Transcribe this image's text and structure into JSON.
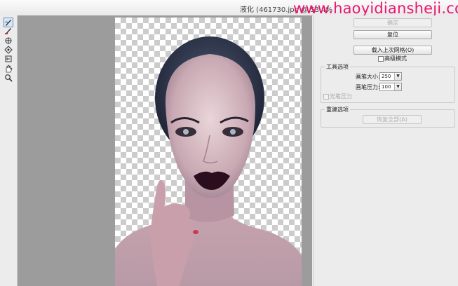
{
  "window": {
    "title": "液化 (461730.jpg @ 53.4%",
    "watermark": "www.haoyidiansheji.com"
  },
  "tools": [
    {
      "name": "forward-warp-tool-icon",
      "active": true
    },
    {
      "name": "reconstruct-tool-icon",
      "active": false
    },
    {
      "name": "pucker-tool-icon",
      "active": false
    },
    {
      "name": "bloat-tool-icon",
      "active": false
    },
    {
      "name": "push-left-tool-icon",
      "active": false
    },
    {
      "name": "hand-tool-icon",
      "active": false
    },
    {
      "name": "zoom-tool-icon",
      "active": false
    }
  ],
  "panel": {
    "ok_label": "确定",
    "reset_label": "复位",
    "load_mesh_label": "载入上次网格(O)",
    "advanced_mode_label": "高级模式",
    "tool_options": {
      "legend": "工具选项",
      "brush_size_label": "画笔大小:",
      "brush_size_value": "250",
      "brush_pressure_label": "画笔压力:",
      "brush_pressure_value": "100",
      "stylus_pressure_label": "光笔压力"
    },
    "reconstruct_options": {
      "legend": "重建选项",
      "restore_all_label": "恢复全部(A)"
    }
  }
}
